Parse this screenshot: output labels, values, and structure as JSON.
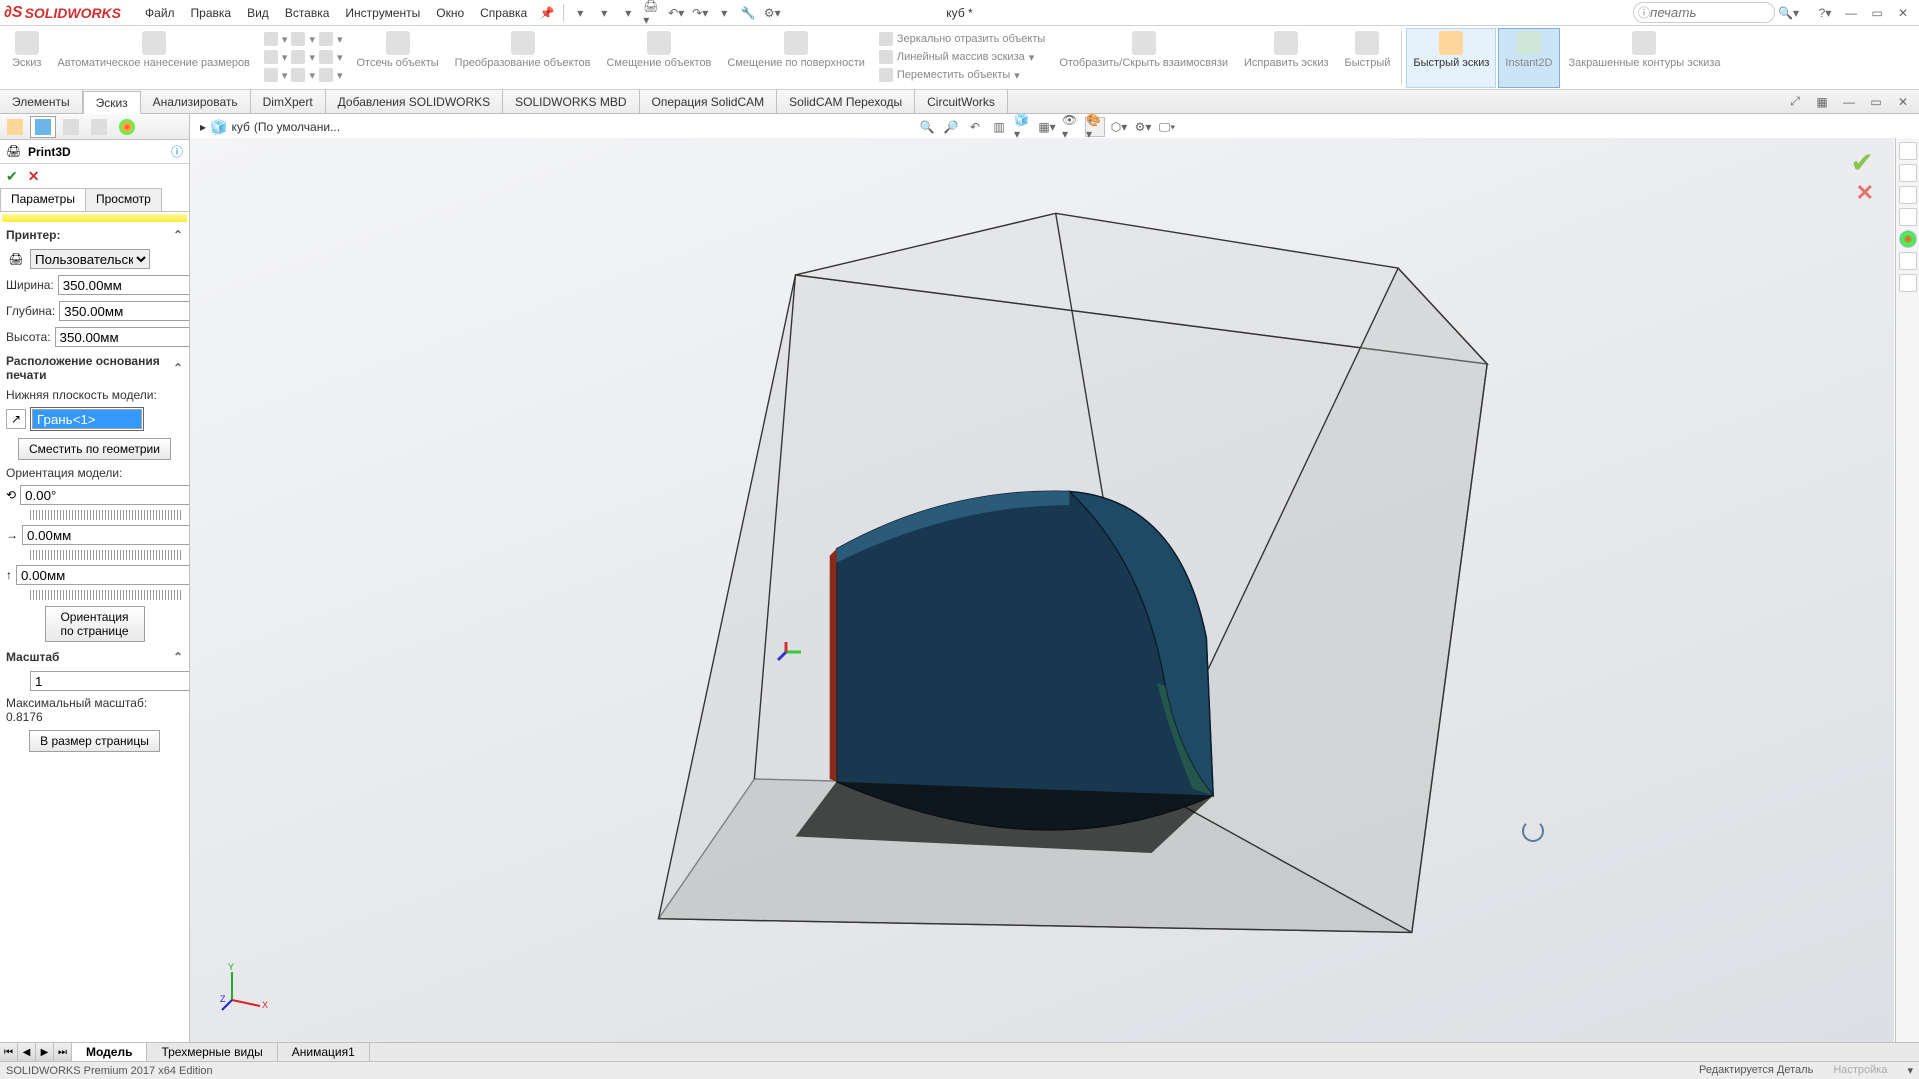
{
  "app": {
    "name": "SOLIDWORKS",
    "doc_title": "куб *",
    "edition": "SOLIDWORKS Premium 2017 x64 Edition"
  },
  "menu": {
    "file": "Файл",
    "edit": "Правка",
    "view": "Вид",
    "insert": "Вставка",
    "tools": "Инструменты",
    "window": "Окно",
    "help": "Справка"
  },
  "search": {
    "placeholder": "печать"
  },
  "ribbon": {
    "sketch": "Эскиз",
    "smartdim": "Автоматическое нанесение размеров",
    "trim": "Отсечь объекты",
    "convert": "Преобразование объектов",
    "offset": "Смещение объектов",
    "offset_surf": "Смещение по поверхности",
    "mirror": "Зеркально отразить объекты",
    "linear": "Линейный массив эскиза",
    "move": "Переместить объекты",
    "relations": "Отобразить/Скрыть взаимосвязи",
    "repair": "Исправить эскиз",
    "quick": "Быстрый",
    "rapid": "Быстрый эскиз",
    "instant2d": "Instant2D",
    "shaded": "Закрашенные контуры эскиза"
  },
  "cmdtabs": {
    "features": "Элементы",
    "sketch": "Эскиз",
    "evaluate": "Анализировать",
    "dimxpert": "DimXpert",
    "addins": "Добавления SOLIDWORKS",
    "mbd": "SOLIDWORKS MBD",
    "solidcam_op": "Операция  SolidCAM",
    "solidcam_tr": "SolidCAM Переходы",
    "circuit": "CircuitWorks"
  },
  "breadcrumb": {
    "part": "куб",
    "config": "(По умолчани..."
  },
  "panel": {
    "title": "Print3D",
    "tab_params": "Параметры",
    "tab_preview": "Просмотр",
    "printer_head": "Принтер:",
    "printer_sel": "Пользовательский прин",
    "width_l": "Ширина:",
    "width_v": "350.00мм",
    "depth_l": "Глубина:",
    "depth_v": "350.00мм",
    "height_l": "Высота:",
    "height_v": "350.00мм",
    "base_head": "Расположение основания печати",
    "bottom_plane": "Нижняя плоскость модели:",
    "face_sel": "Грань<1>",
    "offset_geom": "Сместить по геометрии",
    "orient_head": "Ориентация модели:",
    "angle_v": "0.00°",
    "dx_v": "0.00мм",
    "dy_v": "0.00мм",
    "orient_page": "Ориентация по странице",
    "scale_head": "Масштаб",
    "scale_v": "1",
    "max_scale": "Максимальный масштаб: 0.8176",
    "fit_page": "В размер страницы"
  },
  "bottom_tabs": {
    "model": "Модель",
    "views3d": "Трехмерные виды",
    "anim": "Анимация1"
  },
  "status": {
    "editing": "Редактируется Деталь",
    "custom": "Настройка"
  }
}
